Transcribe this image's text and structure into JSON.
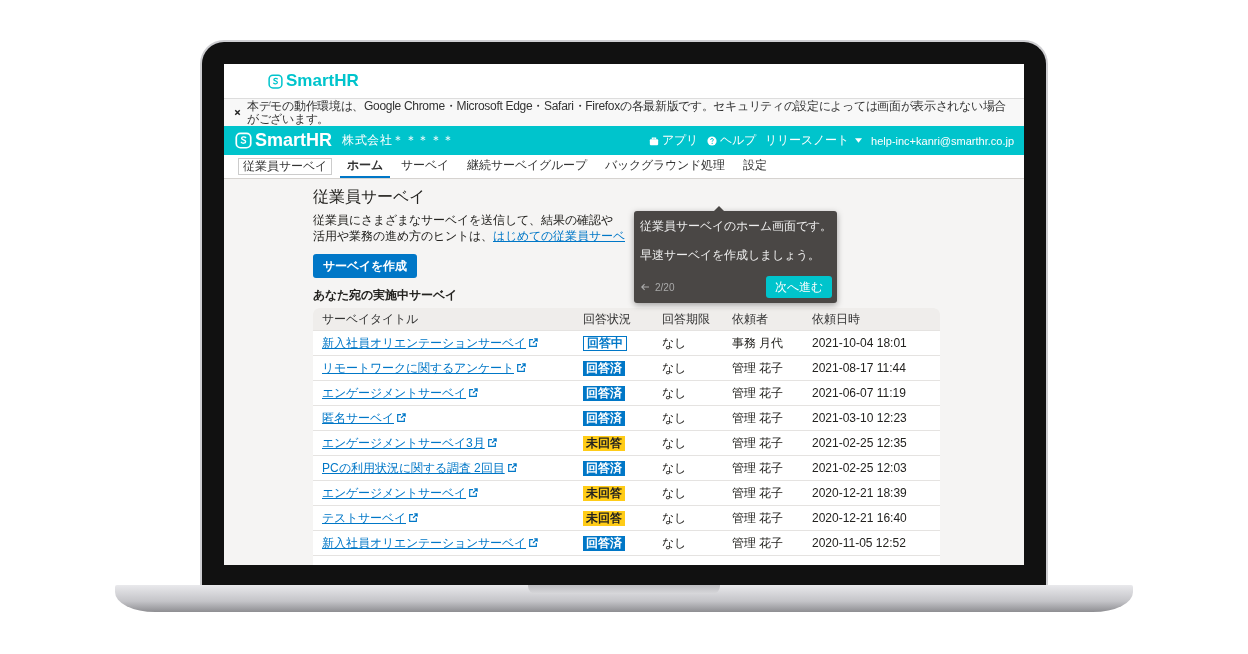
{
  "logo": {
    "text": "SmartHR"
  },
  "notice": {
    "text": "本デモの動作環境は、Google Chrome・Microsoft Edge・Safari・Firefoxの各最新版です。セキュリティの設定によっては画面が表示されない場合がございます。"
  },
  "header": {
    "logo": "SmartHR",
    "company": "株式会社＊＊＊＊＊",
    "links": [
      {
        "kind": "app",
        "label": "アプリ"
      },
      {
        "kind": "help",
        "label": "ヘルプ"
      },
      {
        "kind": "menu",
        "label": "リリースノート"
      }
    ],
    "account": "help-inc+kanri@smarthr.co.jp"
  },
  "nav": {
    "app_label": "従業員サーベイ",
    "tabs": [
      {
        "label": "ホーム",
        "selected": true
      },
      {
        "label": "サーベイ",
        "selected": false
      },
      {
        "label": "継続サーベイグループ",
        "selected": false
      },
      {
        "label": "バックグラウンド処理",
        "selected": false
      },
      {
        "label": "設定",
        "selected": false
      }
    ]
  },
  "page": {
    "title": "従業員サーベイ",
    "description_line_1": "従業員にさまざまなサーベイを送信して、結果の確認や",
    "description_line_2": "活用や業務の進め方のヒントは、",
    "guide_link": "はじめての従業員サーベ",
    "create_button": "サーベイを作成",
    "section_title": "あなた宛の実施中サーベイ"
  },
  "table": {
    "columns": [
      "サーベイタイトル",
      "回答状況",
      "回答期限",
      "依頼者",
      "依頼日時"
    ],
    "rows": [
      {
        "title": "新入社員オリエンテーションサーベイ",
        "status": {
          "kind": "in_progress",
          "label": "回答中"
        },
        "deadline": "なし",
        "requester": "事務 月代",
        "requested_at": "2021-10-04 18:01"
      },
      {
        "title": "リモートワークに関するアンケート",
        "status": {
          "kind": "answered",
          "label": "回答済"
        },
        "deadline": "なし",
        "requester": "管理 花子",
        "requested_at": "2021-08-17 11:44"
      },
      {
        "title": "エンゲージメントサーベイ",
        "status": {
          "kind": "answered",
          "label": "回答済"
        },
        "deadline": "なし",
        "requester": "管理 花子",
        "requested_at": "2021-06-07 11:19"
      },
      {
        "title": "匿名サーベイ",
        "status": {
          "kind": "answered",
          "label": "回答済"
        },
        "deadline": "なし",
        "requester": "管理 花子",
        "requested_at": "2021-03-10 12:23"
      },
      {
        "title": "エンゲージメントサーベイ3月",
        "status": {
          "kind": "unanswered",
          "label": "未回答"
        },
        "deadline": "なし",
        "requester": "管理 花子",
        "requested_at": "2021-02-25 12:35"
      },
      {
        "title": "PCの利用状況に関する調査 2回目",
        "status": {
          "kind": "answered",
          "label": "回答済"
        },
        "deadline": "なし",
        "requester": "管理 花子",
        "requested_at": "2021-02-25 12:03"
      },
      {
        "title": "エンゲージメントサーベイ",
        "status": {
          "kind": "unanswered",
          "label": "未回答"
        },
        "deadline": "なし",
        "requester": "管理 花子",
        "requested_at": "2020-12-21 18:39"
      },
      {
        "title": "テストサーベイ",
        "status": {
          "kind": "unanswered",
          "label": "未回答"
        },
        "deadline": "なし",
        "requester": "管理 花子",
        "requested_at": "2020-12-21 16:40"
      },
      {
        "title": "新入社員オリエンテーションサーベイ",
        "status": {
          "kind": "answered",
          "label": "回答済"
        },
        "deadline": "なし",
        "requester": "管理 花子",
        "requested_at": "2020-11-05 12:52"
      }
    ]
  },
  "tooltip": {
    "lines": [
      "従業員サーベイのホーム画面です。",
      "早速サーベイを作成しましょう。"
    ],
    "step": "2/20",
    "next_button": "次へ進む"
  }
}
